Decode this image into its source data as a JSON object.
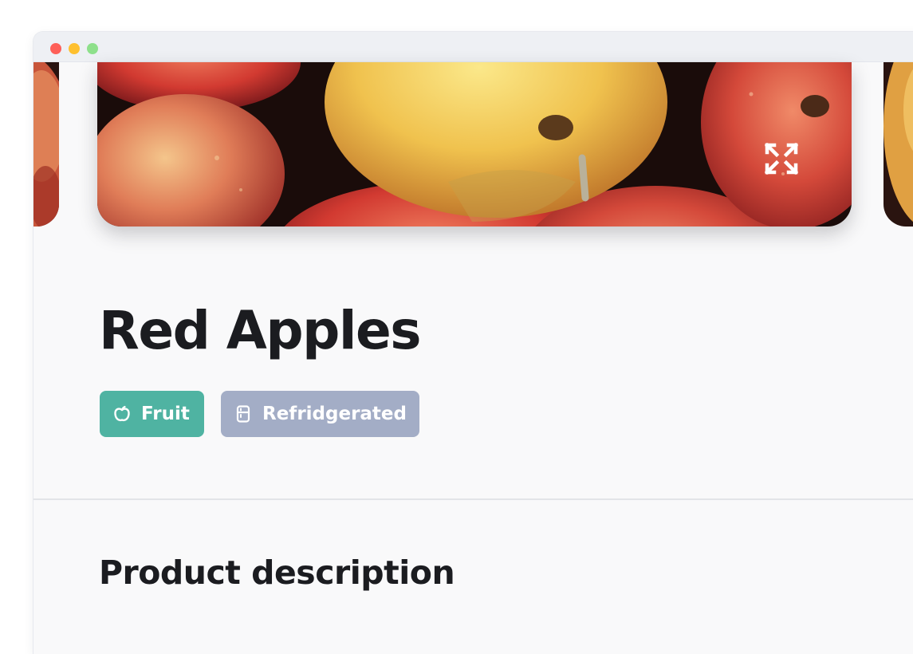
{
  "window": {
    "controls": [
      "close",
      "minimize",
      "maximize"
    ]
  },
  "carousel": {
    "main_image": "red-apples-photo",
    "expand_icon": "expand-icon"
  },
  "product": {
    "title": "Red Apples",
    "tags": [
      {
        "label": "Fruit",
        "icon": "apple-icon",
        "color": "#4fb3a2"
      },
      {
        "label": "Refridgerated",
        "icon": "fridge-icon",
        "color": "#a3adc6"
      }
    ]
  },
  "sections": {
    "description_title": "Product description"
  }
}
